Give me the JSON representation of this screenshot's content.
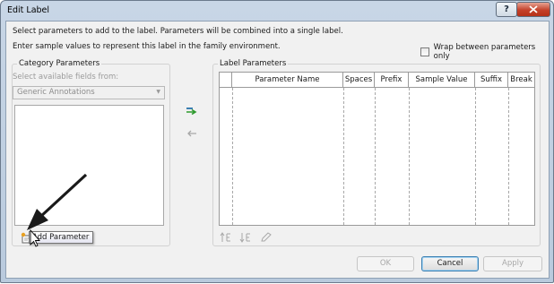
{
  "window": {
    "title": "Edit Label"
  },
  "titlebar": {
    "help_glyph": "?"
  },
  "intro": {
    "line1": "Select parameters to add to the label.  Parameters will be combined into a single label.",
    "line2": "Enter sample values to represent this label in the family environment."
  },
  "options": {
    "wrap_label": "Wrap between parameters only",
    "wrap_checked": false
  },
  "category": {
    "group_label": "Category Parameters",
    "select_label": "Select available fields from:",
    "selected_category": "Generic Annotations",
    "icons": [
      "add-parameter-icon",
      "edit-parameter-icon",
      "delete-parameter-icon"
    ]
  },
  "transfer": {
    "icons": [
      "add-to-label-icon",
      "remove-from-label-icon"
    ]
  },
  "label_params": {
    "group_label": "Label Parameters",
    "columns": [
      "Parameter Name",
      "Spaces",
      "Prefix",
      "Sample Value",
      "Suffix",
      "Break"
    ],
    "icons": [
      "move-up-icon",
      "move-down-icon",
      "edit-sample-icon"
    ]
  },
  "buttons": {
    "ok": "OK",
    "cancel": "Cancel",
    "apply": "Apply"
  },
  "tooltip": {
    "text": "Add Parameter"
  },
  "colors": {
    "accent": "#3c7fb1",
    "title_frame": "#c8d6e6",
    "close": "#c4412a",
    "annotation": "#1a1a1a"
  }
}
